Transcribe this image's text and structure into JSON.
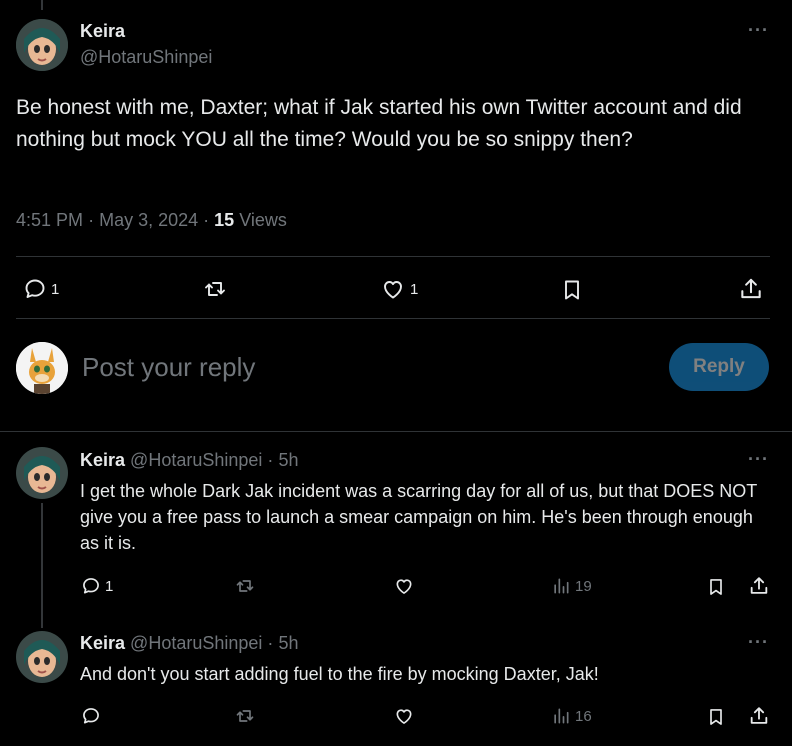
{
  "main_tweet": {
    "display_name": "Keira",
    "handle": "@HotaruShinpei",
    "text": "Be honest with me, Daxter; what if Jak started his own Twitter account and did nothing but mock YOU all the time? Would you be so snippy then?",
    "time": "4:51 PM",
    "date": "May 3, 2024",
    "separator": "·",
    "views_count": "15",
    "views_label": "Views",
    "reply_count": "1",
    "like_count": "1"
  },
  "reply_box": {
    "placeholder": "Post your reply",
    "button_label": "Reply"
  },
  "replies": [
    {
      "display_name": "Keira",
      "handle": "@HotaruShinpei",
      "separator": "·",
      "age": "5h",
      "text": "I get the whole Dark Jak incident was a scarring day for all of us, but that DOES NOT give you a free pass to launch a smear campaign on him. He's been through enough as it is.",
      "reply_count": "1",
      "views": "19"
    },
    {
      "display_name": "Keira",
      "handle": "@HotaruShinpei",
      "separator": "·",
      "age": "5h",
      "text": "And don't you start adding fuel to the fire by mocking Daxter, Jak!",
      "reply_count": "",
      "views": "16"
    }
  ],
  "colors": {
    "background": "#000000",
    "text": "#e7e9ea",
    "muted": "#71767b",
    "divider": "#2f3336",
    "reply_button": "#1d9bf0"
  }
}
